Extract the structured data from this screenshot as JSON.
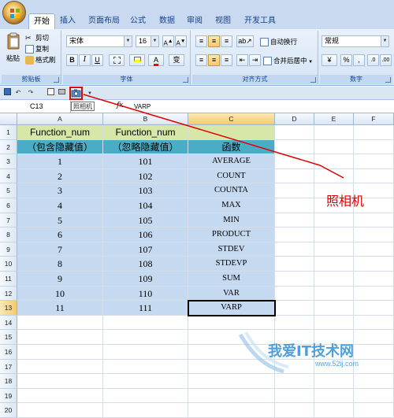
{
  "ribbon": {
    "tabs": [
      "开始",
      "插入",
      "页面布局",
      "公式",
      "数据",
      "审阅",
      "视图",
      "开发工具"
    ],
    "clipboard": {
      "paste": "粘贴",
      "cut": "剪切",
      "copy": "复制",
      "format_painter": "格式刷",
      "group_label": "剪贴板"
    },
    "font": {
      "name": "宋体",
      "size": "16",
      "bold": "B",
      "italic": "I",
      "underline": "U",
      "phonetic": "变",
      "group_label": "字体"
    },
    "alignment": {
      "wrap_text": "自动换行",
      "merge_center": "合并后居中",
      "group_label": "对齐方式"
    },
    "number": {
      "format": "常规",
      "percent": "%",
      "comma": ",",
      "group_label": "数字"
    }
  },
  "qat": {
    "camera_tooltip": "照相机"
  },
  "formula_bar": {
    "name_box": "C13",
    "fx": "fx",
    "value": "VARP"
  },
  "sheet": {
    "columns": [
      "A",
      "B",
      "C",
      "D",
      "E",
      "F"
    ],
    "rows": [
      "1",
      "2",
      "3",
      "4",
      "5",
      "6",
      "7",
      "8",
      "9",
      "10",
      "11",
      "12",
      "13",
      "14",
      "15",
      "16",
      "17",
      "18",
      "19",
      "20"
    ],
    "header1": [
      "Function_num",
      "Function_num",
      ""
    ],
    "header2": [
      "（包含隐藏值）",
      "（忽略隐藏值）",
      "函数"
    ],
    "data": [
      [
        "1",
        "101",
        "AVERAGE"
      ],
      [
        "2",
        "102",
        "COUNT"
      ],
      [
        "3",
        "103",
        "COUNTA"
      ],
      [
        "4",
        "104",
        "MAX"
      ],
      [
        "5",
        "105",
        "MIN"
      ],
      [
        "6",
        "106",
        "PRODUCT"
      ],
      [
        "7",
        "107",
        "STDEV"
      ],
      [
        "8",
        "108",
        "STDEVP"
      ],
      [
        "9",
        "109",
        "SUM"
      ],
      [
        "10",
        "110",
        "VAR"
      ],
      [
        "11",
        "111",
        "VARP"
      ]
    ]
  },
  "annotation": {
    "label": "照相机",
    "color": "#d90000"
  },
  "watermark": {
    "text": "我爱IT技术网",
    "url": "www.52ij.com"
  }
}
